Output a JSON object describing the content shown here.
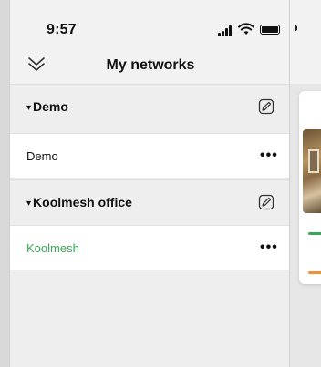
{
  "status_bar": {
    "time": "9:57"
  },
  "header": {
    "title": "My networks",
    "collapse_icon": "chevron-double-down-icon"
  },
  "groups": [
    {
      "name": "Demo",
      "collapse_marker": "▾",
      "edit_icon": "edit-icon",
      "items": [
        {
          "label": "Demo",
          "active": false,
          "more_icon": "ellipsis-icon"
        }
      ]
    },
    {
      "name": "Koolmesh office",
      "collapse_marker": "▾",
      "edit_icon": "edit-icon",
      "items": [
        {
          "label": "Koolmesh",
          "active": true,
          "more_icon": "ellipsis-icon"
        }
      ]
    }
  ],
  "colors": {
    "active_item": "#3aa65a",
    "background_bar_green": "#3aa65a",
    "background_bar_orange": "#f0923a"
  },
  "background_app": {
    "menu_icon": "list-icon"
  }
}
